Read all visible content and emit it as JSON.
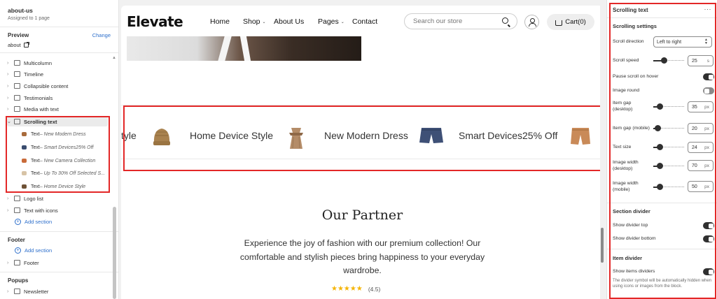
{
  "left": {
    "page_title": "about-us",
    "page_subtitle": "Assigned to 1 page",
    "preview_label": "Preview",
    "change_label": "Change",
    "preview_page": "about",
    "sections": [
      {
        "label": "Multicolumn"
      },
      {
        "label": "Timeline"
      },
      {
        "label": "Collapsible content"
      },
      {
        "label": "Testimonials"
      },
      {
        "label": "Media with text"
      },
      {
        "label": "Scrolling text"
      }
    ],
    "scrolling_children": [
      {
        "prefix": "Text",
        "detail": " – New Modern Dress",
        "color": "#a86b3c"
      },
      {
        "prefix": "Text",
        "detail": " – Smart Devices25% Off",
        "color": "#3a4d6f"
      },
      {
        "prefix": "Text",
        "detail": " – New Camera Collection",
        "color": "#c96b3a"
      },
      {
        "prefix": "Text",
        "detail": " – Up To 30% Off Selected S...",
        "color": "#d7c3a6"
      },
      {
        "prefix": "Text",
        "detail": " – Home Device Style",
        "color": "#6e5236"
      }
    ],
    "after_sections": [
      {
        "label": "Logo list"
      },
      {
        "label": "Text with icons"
      }
    ],
    "add_section": "Add section",
    "footer_group": "Footer",
    "footer_add": "Add section",
    "footer_item": "Footer",
    "popups_group": "Popups",
    "popups_item": "Newsletter"
  },
  "store": {
    "logo": "Elevate",
    "nav": [
      "Home",
      "Shop",
      "About Us",
      "Pages",
      "Contact"
    ],
    "search_placeholder": "Search our store",
    "cart_label": "Cart(0)",
    "marquee": [
      "tyle",
      "Home Device Style",
      "New Modern Dress",
      "Smart Devices25% Off"
    ],
    "partner_title": "Our Partner",
    "partner_text": "Experience the joy of fashion with our premium collection! Our comfortable and stylish pieces bring happiness to your everyday wardrobe.",
    "stars": "★★★★★",
    "rating_value": "(4.5)"
  },
  "settings": {
    "title": "Scrolling text",
    "more": "···",
    "section_heading": "Scrolling settings",
    "scroll_direction_label": "Scroll direction",
    "scroll_direction_value": "Left to right",
    "scroll_speed_label": "Scroll speed",
    "scroll_speed_value": "25",
    "scroll_speed_unit": "s",
    "pause_label": "Pause scroll on hover",
    "pause_value": true,
    "image_round_label": "Image round",
    "image_round_value": false,
    "gap_desktop_label": "Item gap (desktop)",
    "gap_desktop_value": "35",
    "gap_mobile_label": "Item gap (mobile)",
    "gap_mobile_value": "20",
    "text_size_label": "Text size",
    "text_size_value": "24",
    "img_w_desktop_label": "Image width (desktop)",
    "img_w_desktop_value": "70",
    "img_w_mobile_label": "Image width (mobile)",
    "img_w_mobile_value": "50",
    "unit_px": "px",
    "section_divider_heading": "Section divider",
    "show_divider_top_label": "Show divider top",
    "show_divider_top_value": true,
    "show_divider_bottom_label": "Show divider bottom",
    "show_divider_bottom_value": true,
    "item_divider_heading": "Item divider",
    "show_items_dividers_label": "Show items dividers",
    "show_items_dividers_value": true,
    "note": "The divider symbol will be automatically hidden when using icons or images from the block."
  },
  "colors": {
    "highlight": "#e32727",
    "link": "#2c6ecb",
    "star": "#f5b400"
  }
}
